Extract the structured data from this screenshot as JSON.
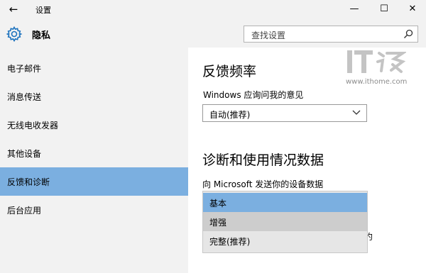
{
  "window": {
    "back_glyph": "←",
    "title": "设置",
    "minimize_glyph": "—",
    "maximize_glyph": "☐",
    "close_glyph": "✕"
  },
  "header": {
    "icon": "gear-icon",
    "title": "隐私",
    "search_placeholder": "查找设置"
  },
  "sidebar": {
    "items": [
      {
        "label": "电子邮件"
      },
      {
        "label": "消息传送"
      },
      {
        "label": "无线电收发器"
      },
      {
        "label": "其他设备"
      },
      {
        "label": "反馈和诊断",
        "active": true
      },
      {
        "label": "后台应用"
      }
    ]
  },
  "main": {
    "feedback_heading": "反馈频率",
    "feedback_label": "Windows 应询问我的意见",
    "feedback_value": "自动(推荐)",
    "diag_heading": "诊断和使用情况数据",
    "send_label": "向 Microsoft 发送你的设备数据",
    "dropdown_options": [
      {
        "label": "基本",
        "state": "selected"
      },
      {
        "label": "增强",
        "state": "hover"
      },
      {
        "label": "完整(推荐)",
        "state": "normal"
      }
    ],
    "partial_text": "约"
  },
  "watermark": {
    "url": "www.ithome.com"
  },
  "colors": {
    "chrome_bg": "#f2f2f2",
    "accent": "#7bafe0",
    "hover": "#cdcdcd",
    "gear": "#1e73be"
  }
}
